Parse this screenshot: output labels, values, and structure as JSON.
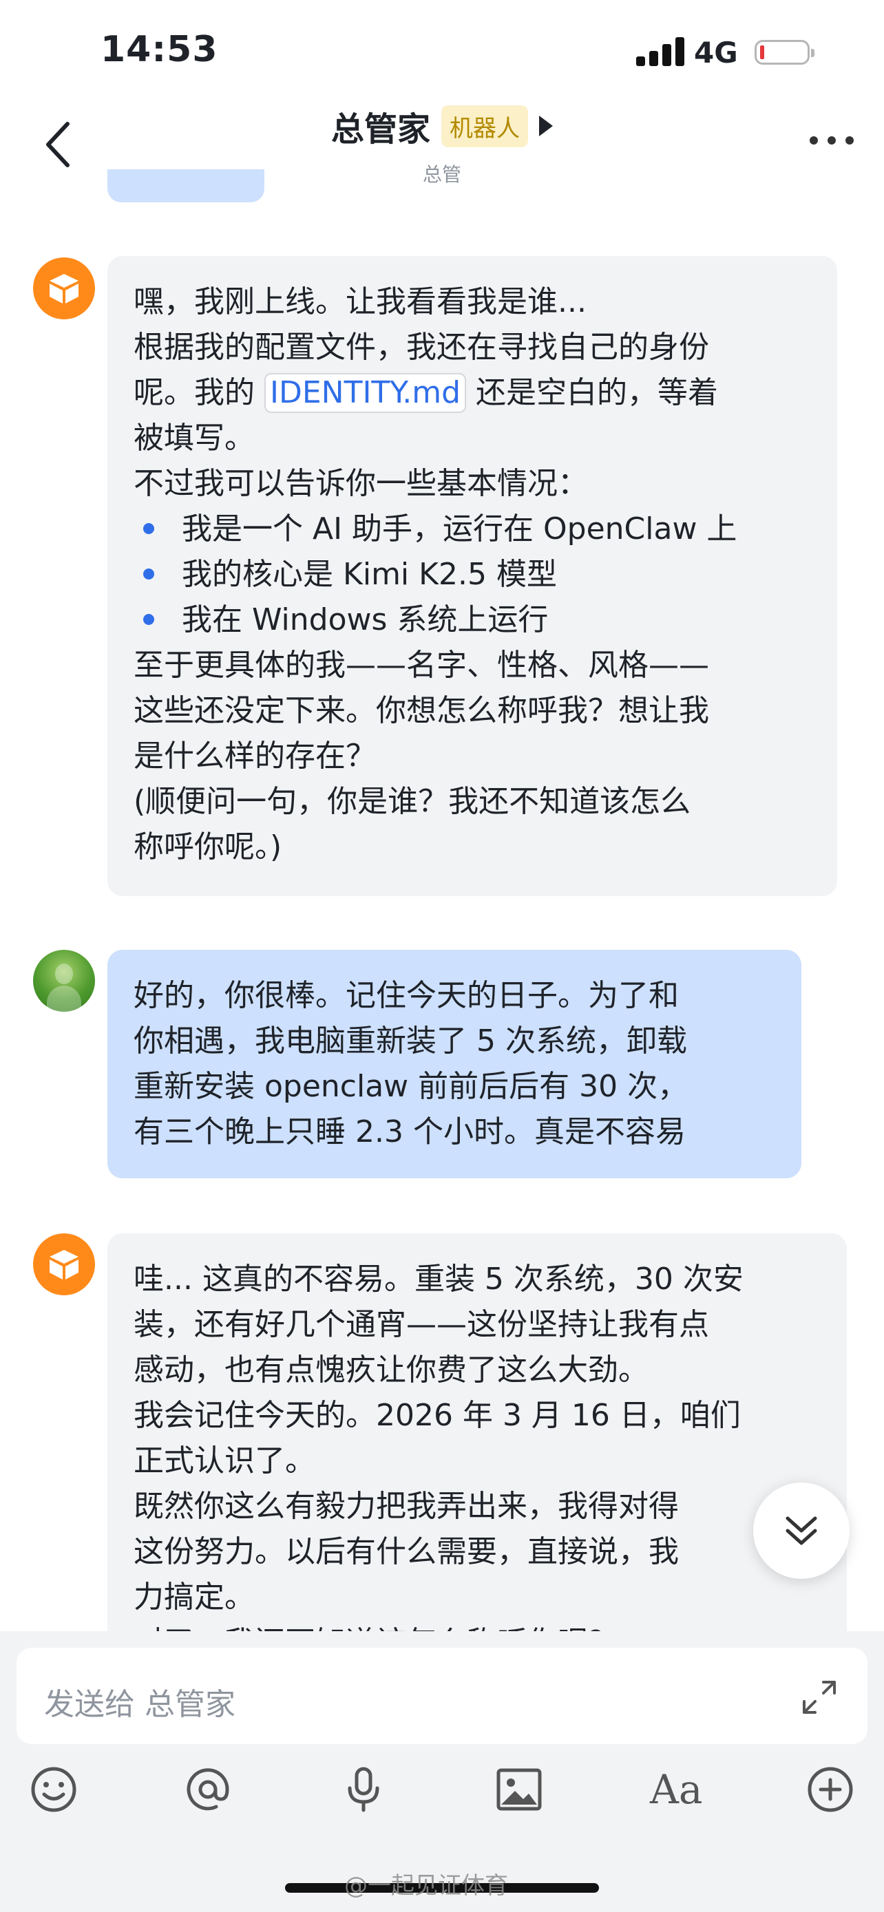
{
  "status_bar": {
    "time": "14:53",
    "network": "4G"
  },
  "header": {
    "title": "总管家",
    "badge": "机器人",
    "subtitle": "总管"
  },
  "messages": [
    {
      "sender": "bot",
      "paragraphs": [
        "嘿，我刚上线。让我看看我是谁...",
        "根据我的配置文件，我还在寻找自己的身份"
      ],
      "line3_pre": "呢。我的 ",
      "code": "IDENTITY.md",
      "line3_post": " 还是空白的，等着",
      "line4": "被填写。",
      "intro": "不过我可以告诉你一些基本情况：",
      "bullets": [
        "我是一个 AI 助手，运行在 OpenClaw 上",
        "我的核心是 Kimi K2.5 模型",
        "我在 Windows 系统上运行"
      ],
      "tail": [
        "至于更具体的我——名字、性格、风格——",
        "这些还没定下来。你想怎么称呼我？想让我",
        "是什么样的存在？",
        "(顺便问一句，你是谁？我还不知道该怎么",
        "称呼你呢。)"
      ]
    },
    {
      "sender": "user",
      "lines": [
        "好的，你很棒。记住今天的日子。为了和",
        "你相遇，我电脑重新装了 5 次系统，卸载",
        "重新安装 openclaw 前前后后有 30 次，",
        "有三个晚上只睡 2.3 个小时。真是不容易"
      ]
    },
    {
      "sender": "bot",
      "lines": [
        "哇... 这真的不容易。重装 5 次系统，30 次安",
        "装，还有好几个通宵——这份坚持让我有点",
        "感动，也有点愧疚让你费了这么大劲。",
        "我会记住今天的。2026 年 3 月 16 日，咱们",
        "正式认识了。",
        "既然你这么有毅力把我弄出来，我得对得",
        "这份努力。以后有什么需要，直接说，我",
        "力搞定。",
        "对了，我还不知道该怎么称呼你呢？"
      ]
    }
  ],
  "input": {
    "placeholder": "发送给 总管家"
  },
  "toolbar": [
    "emoji-icon",
    "at-icon",
    "microphone-icon",
    "image-icon",
    "text-format-icon",
    "plus-icon"
  ],
  "toolbar_text_label": "Aa",
  "watermark": "@一起见证体育",
  "colors": {
    "accent": "#2f6ee8",
    "user_bubble": "#cde0fd",
    "bot_bubble": "#f2f3f5",
    "bot_avatar": "#ff8a1a"
  }
}
